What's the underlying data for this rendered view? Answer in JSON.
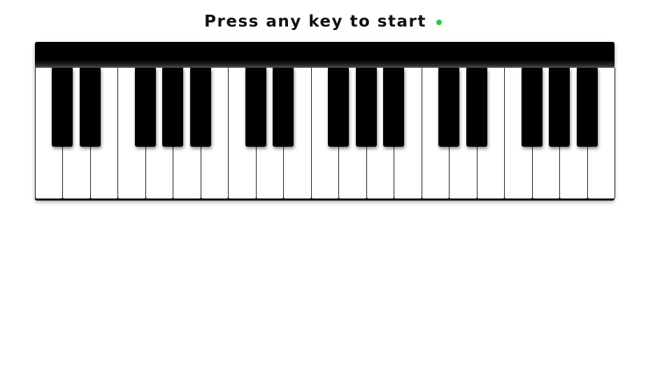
{
  "header": {
    "prompt": "Press any key to start",
    "status_indicator_color": "#2ecc40"
  },
  "piano": {
    "white_key_count": 21,
    "black_key_pattern": [
      1,
      1,
      0,
      1,
      1,
      1,
      0,
      1,
      1,
      0,
      1,
      1,
      1,
      0,
      1,
      1,
      0,
      1,
      1,
      1
    ],
    "white_key_color": "#ffffff",
    "black_key_color": "#000000"
  }
}
